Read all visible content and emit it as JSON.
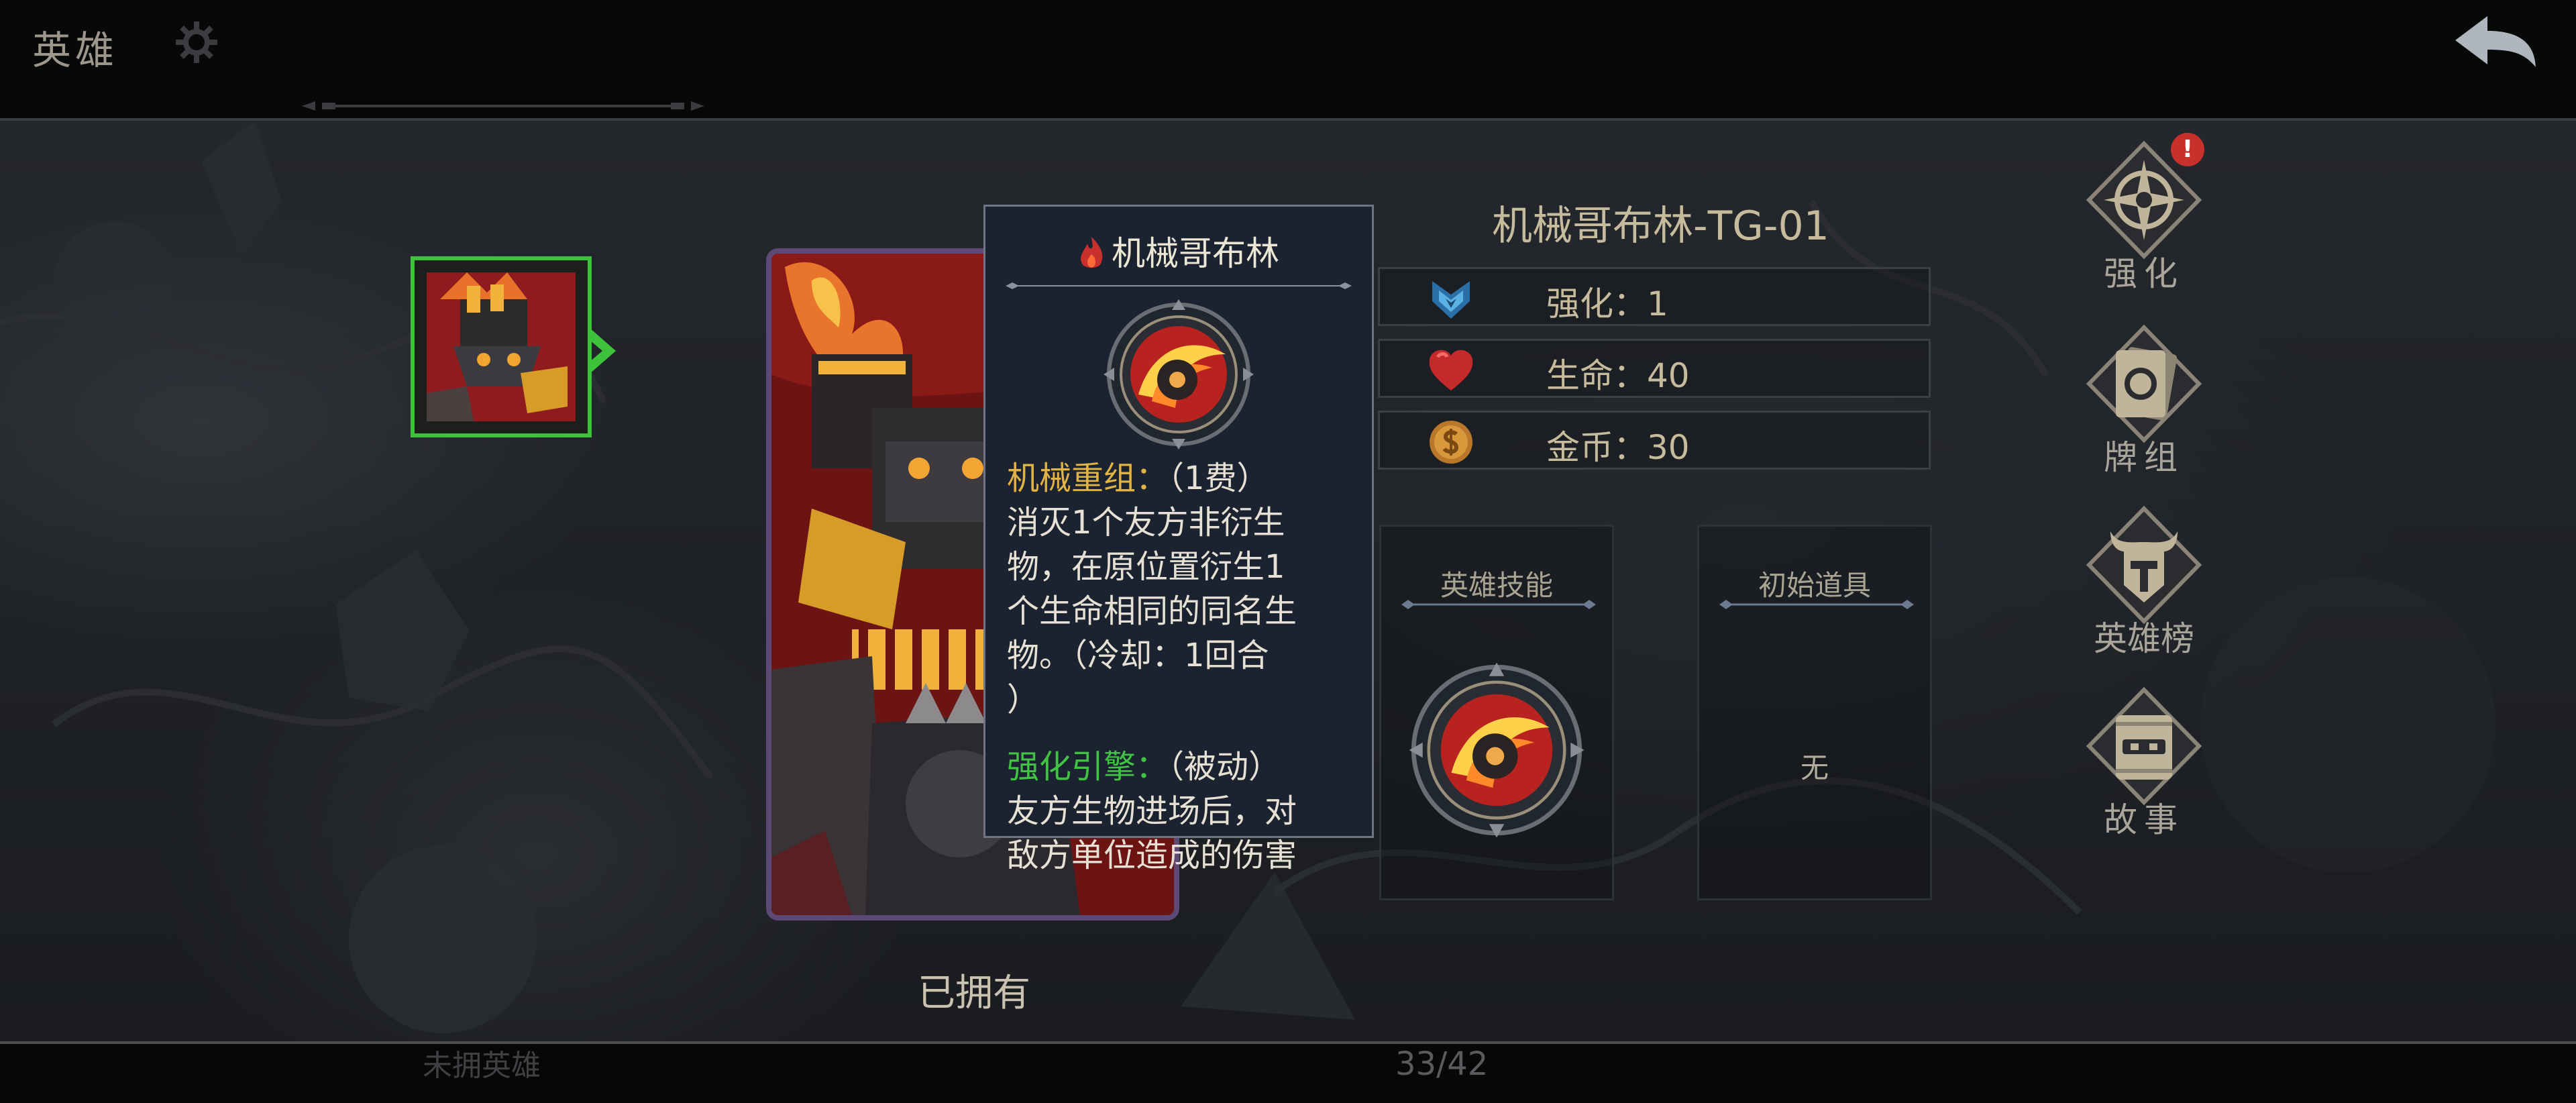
{
  "header": {
    "title": "英雄"
  },
  "footer": {
    "faded_text": "未拥英雄",
    "page_indicator": "33/42"
  },
  "card": {
    "owned_label": "已拥有"
  },
  "tooltip": {
    "card_name": "机械哥布林",
    "skill1_name": "机械重组：",
    "skill1_cost": "（1费）",
    "skill1_lines": [
      "消灭1个友方非衍生",
      "物，在原位置衍生1",
      "个生命相同的同名生",
      "物。（冷却：1回合",
      "）"
    ],
    "skill2_name": "强化引擎：",
    "skill2_type": "（被动）",
    "skill2_lines": [
      "友方生物进场后，对",
      "敌方单位造成的伤害"
    ]
  },
  "hero": {
    "name": "机械哥布林-TG-01",
    "stats": [
      {
        "label": "强化：1",
        "icon": "upgrade-icon"
      },
      {
        "label": "生命：40",
        "icon": "heart-icon"
      },
      {
        "label": "金币：30",
        "icon": "coin-icon"
      }
    ]
  },
  "panels": {
    "skill_title": "英雄技能",
    "item_title": "初始道具",
    "item_value": "无"
  },
  "nav": {
    "upgrade": "强化",
    "deck": "牌组",
    "ranking": "英雄榜",
    "story": "故事",
    "badge": "!"
  },
  "colors": {
    "accent_gold": "#e0b344",
    "accent_green": "#42c245",
    "selection_green": "#3ec23c",
    "badge_red": "#c8302c"
  }
}
